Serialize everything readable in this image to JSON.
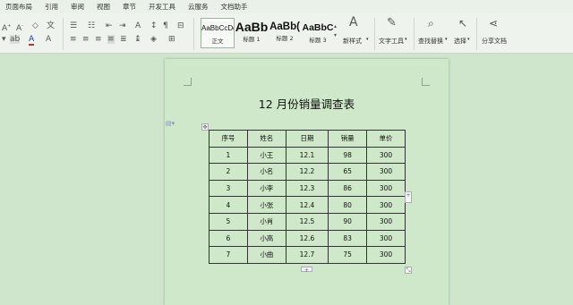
{
  "menu": [
    "页面布局",
    "引用",
    "审阅",
    "视图",
    "章节",
    "开发工具",
    "云服务",
    "文档助手"
  ],
  "ribbon": {
    "styles": [
      {
        "sample": "AaBbCcDd",
        "name": "正文"
      },
      {
        "sample": "AaBb",
        "name": "标题 1"
      },
      {
        "sample": "AaBb(",
        "name": "标题 2"
      },
      {
        "sample": "AaBbC",
        "name": "标题 3"
      }
    ],
    "new_style": "新样式",
    "text_tools": "文字工具",
    "find_replace": "查找替换",
    "select": "选择",
    "share_doc": "分享文档"
  },
  "document": {
    "title": "12 月份销量调查表",
    "table": {
      "headers": [
        "序号",
        "姓名",
        "日期",
        "销量",
        "单价"
      ],
      "rows": [
        [
          "1",
          "小王",
          "12.1",
          "98",
          "300"
        ],
        [
          "2",
          "小名",
          "12.2",
          "65",
          "300"
        ],
        [
          "3",
          "小李",
          "12.3",
          "86",
          "300"
        ],
        [
          "4",
          "小张",
          "12.4",
          "80",
          "300"
        ],
        [
          "5",
          "小肖",
          "12.5",
          "90",
          "300"
        ],
        [
          "6",
          "小高",
          "12.6",
          "83",
          "300"
        ],
        [
          "7",
          "小曲",
          "12.7",
          "75",
          "300"
        ]
      ]
    }
  }
}
